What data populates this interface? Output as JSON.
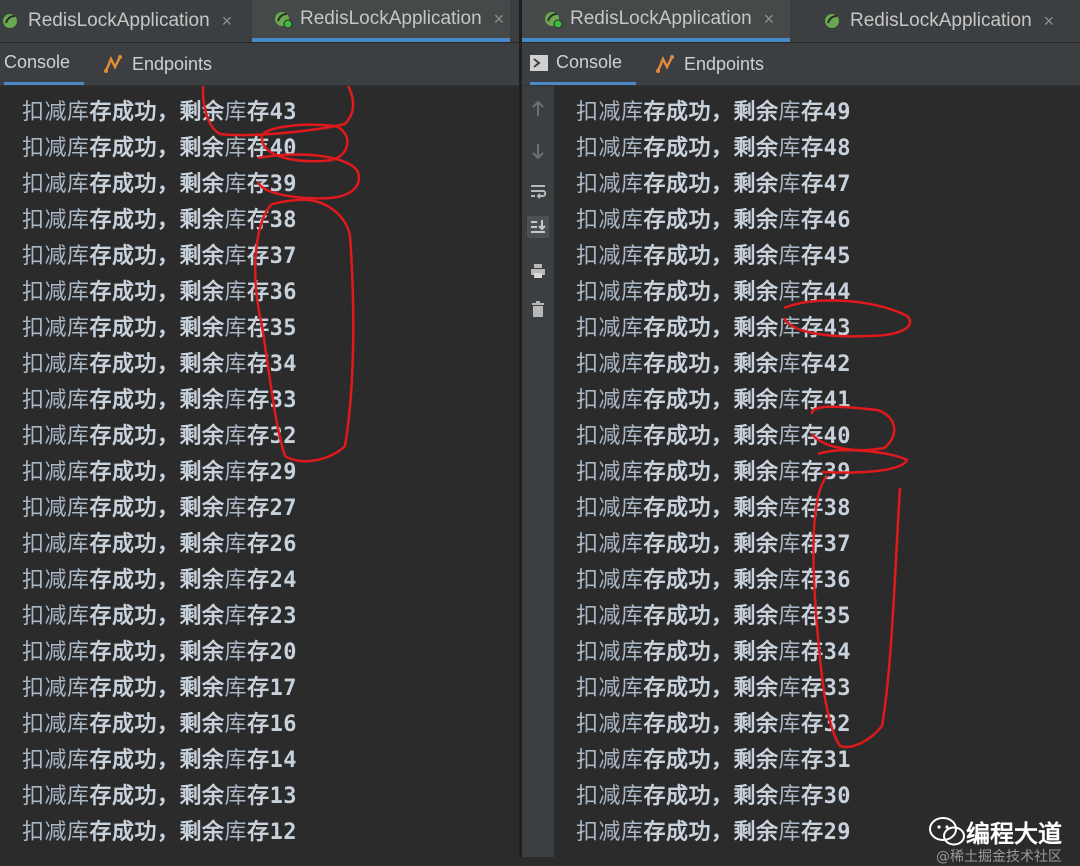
{
  "left": {
    "tabs": [
      {
        "label": "RedisLockApplication",
        "close": "×",
        "active": false
      },
      {
        "label": "RedisLockApplication",
        "close": "×",
        "active": true
      }
    ],
    "tool_tabs": [
      {
        "label": "Console",
        "active": true
      },
      {
        "label": "Endpoints",
        "active": false
      }
    ],
    "lines": [
      {
        "a": "扣减库",
        "b": "存成功，",
        "c": "剩余",
        "d": "库",
        "e": "存43"
      },
      {
        "a": "扣减库",
        "b": "存成功，",
        "c": "剩余",
        "d": "库",
        "e": "存40"
      },
      {
        "a": "扣减库",
        "b": "存成功，",
        "c": "剩余",
        "d": "库",
        "e": "存39"
      },
      {
        "a": "扣减库",
        "b": "存成功，",
        "c": "剩余",
        "d": "库",
        "e": "存38"
      },
      {
        "a": "扣减库",
        "b": "存成功，",
        "c": "剩余",
        "d": "库",
        "e": "存37"
      },
      {
        "a": "扣减库",
        "b": "存成功，",
        "c": "剩余",
        "d": "库",
        "e": "存36"
      },
      {
        "a": "扣减库",
        "b": "存成功，",
        "c": "剩余",
        "d": "库",
        "e": "存35"
      },
      {
        "a": "扣减库",
        "b": "存成功，",
        "c": "剩余",
        "d": "库",
        "e": "存34"
      },
      {
        "a": "扣减库",
        "b": "存成功，",
        "c": "剩余",
        "d": "库",
        "e": "存33"
      },
      {
        "a": "扣减库",
        "b": "存成功，",
        "c": "剩余",
        "d": "库",
        "e": "存32"
      },
      {
        "a": "扣减库",
        "b": "存成功，",
        "c": "剩余",
        "d": "库",
        "e": "存29"
      },
      {
        "a": "扣减库",
        "b": "存成功，",
        "c": "剩余",
        "d": "库",
        "e": "存27"
      },
      {
        "a": "扣减库",
        "b": "存成功，",
        "c": "剩余",
        "d": "库",
        "e": "存26"
      },
      {
        "a": "扣减库",
        "b": "存成功，",
        "c": "剩余",
        "d": "库",
        "e": "存24"
      },
      {
        "a": "扣减库",
        "b": "存成功，",
        "c": "剩余",
        "d": "库",
        "e": "存23"
      },
      {
        "a": "扣减库",
        "b": "存成功，",
        "c": "剩余",
        "d": "库",
        "e": "存20"
      },
      {
        "a": "扣减库",
        "b": "存成功，",
        "c": "剩余",
        "d": "库",
        "e": "存17"
      },
      {
        "a": "扣减库",
        "b": "存成功，",
        "c": "剩余",
        "d": "库",
        "e": "存16"
      },
      {
        "a": "扣减库",
        "b": "存成功，",
        "c": "剩余",
        "d": "库",
        "e": "存14"
      },
      {
        "a": "扣减库",
        "b": "存成功，",
        "c": "剩余",
        "d": "库",
        "e": "存13"
      },
      {
        "a": "扣减库",
        "b": "存成功，",
        "c": "剩余",
        "d": "库",
        "e": "存12"
      }
    ]
  },
  "right": {
    "tabs": [
      {
        "label": "RedisLockApplication",
        "close": "×",
        "active": true
      },
      {
        "label": "RedisLockApplication",
        "close": "×",
        "active": false
      }
    ],
    "tool_tabs": [
      {
        "label": "Console",
        "active": true
      },
      {
        "label": "Endpoints",
        "active": false
      }
    ],
    "gutter_icons": [
      "up-arrow-icon",
      "down-arrow-icon",
      "soft-wrap-icon",
      "scroll-to-end-icon",
      "print-icon",
      "trash-icon"
    ],
    "lines": [
      {
        "a": "扣减库",
        "b": "存成功，",
        "c": "剩余",
        "d": "库",
        "e": "存49"
      },
      {
        "a": "扣减库",
        "b": "存成功，",
        "c": "剩余",
        "d": "库",
        "e": "存48"
      },
      {
        "a": "扣减库",
        "b": "存成功，",
        "c": "剩余",
        "d": "库",
        "e": "存47"
      },
      {
        "a": "扣减库",
        "b": "存成功，",
        "c": "剩余",
        "d": "库",
        "e": "存46"
      },
      {
        "a": "扣减库",
        "b": "存成功，",
        "c": "剩余",
        "d": "库",
        "e": "存45"
      },
      {
        "a": "扣减库",
        "b": "存成功，",
        "c": "剩余",
        "d": "库",
        "e": "存44"
      },
      {
        "a": "扣减库",
        "b": "存成功，",
        "c": "剩余",
        "d": "库",
        "e": "存43"
      },
      {
        "a": "扣减库",
        "b": "存成功，",
        "c": "剩余",
        "d": "库",
        "e": "存42"
      },
      {
        "a": "扣减库",
        "b": "存成功，",
        "c": "剩余",
        "d": "库",
        "e": "存41"
      },
      {
        "a": "扣减库",
        "b": "存成功，",
        "c": "剩余",
        "d": "库",
        "e": "存40"
      },
      {
        "a": "扣减库",
        "b": "存成功，",
        "c": "剩余",
        "d": "库",
        "e": "存39"
      },
      {
        "a": "扣减库",
        "b": "存成功，",
        "c": "剩余",
        "d": "库",
        "e": "存38"
      },
      {
        "a": "扣减库",
        "b": "存成功，",
        "c": "剩余",
        "d": "库",
        "e": "存37"
      },
      {
        "a": "扣减库",
        "b": "存成功，",
        "c": "剩余",
        "d": "库",
        "e": "存36"
      },
      {
        "a": "扣减库",
        "b": "存成功，",
        "c": "剩余",
        "d": "库",
        "e": "存35"
      },
      {
        "a": "扣减库",
        "b": "存成功，",
        "c": "剩余",
        "d": "库",
        "e": "存34"
      },
      {
        "a": "扣减库",
        "b": "存成功，",
        "c": "剩余",
        "d": "库",
        "e": "存33"
      },
      {
        "a": "扣减库",
        "b": "存成功，",
        "c": "剩余",
        "d": "库",
        "e": "存32"
      },
      {
        "a": "扣减库",
        "b": "存成功，",
        "c": "剩余",
        "d": "库",
        "e": "存31"
      },
      {
        "a": "扣减库",
        "b": "存成功，",
        "c": "剩余",
        "d": "库",
        "e": "存30"
      },
      {
        "a": "扣减库",
        "b": "存成功，",
        "c": "剩余",
        "d": "库",
        "e": "存29"
      }
    ]
  },
  "watermark": {
    "title": "编程大道",
    "subtitle": "@稀土掘金技术社区"
  },
  "colors": {
    "console_bg": "#2b2b2b",
    "toolbar_bg": "#3c3f41",
    "text": "#a9b7c6",
    "accent": "#4a88c7",
    "annotation": "#e0191d"
  }
}
